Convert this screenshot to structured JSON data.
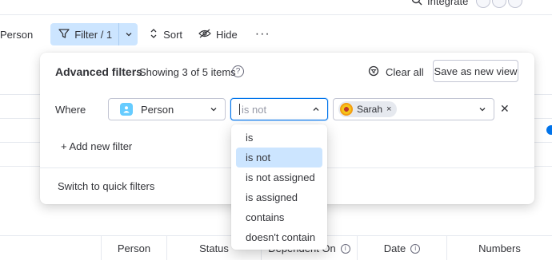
{
  "header": {
    "integrate_label": "Integrate"
  },
  "toolbar": {
    "person_label": "Person",
    "filter_label": "Filter / 1",
    "sort_label": "Sort",
    "hide_label": "Hide",
    "more_label": "···"
  },
  "table": {
    "columns": [
      {
        "label": "Person",
        "info": false
      },
      {
        "label": "Status",
        "info": false
      },
      {
        "label": "Dependent On",
        "info": true
      },
      {
        "label": "Date",
        "info": true
      },
      {
        "label": "Numbers",
        "info": false
      }
    ]
  },
  "filter_panel": {
    "title": "Advanced filters",
    "subtitle": "Showing 3 of 5 items",
    "help_icon": "?",
    "clear_all_label": "Clear all",
    "save_view_label": "Save as new view",
    "where_label": "Where",
    "column_select": {
      "value": "Person",
      "icon": "person-column-icon"
    },
    "condition_select": {
      "value": "is not"
    },
    "value_select": {
      "chip_label": "Sarah",
      "chip_remove": "×"
    },
    "remove_row": "✕",
    "add_filter_label": "+ Add new filter",
    "quick_filters_label": "Switch to quick filters"
  },
  "condition_menu": {
    "options": [
      "is",
      "is not",
      "is not assigned",
      "is assigned",
      "contains",
      "doesn't contain"
    ],
    "selected": "is not"
  },
  "colors": {
    "accent": "#0073ea",
    "selected_bg": "#cce5ff",
    "border": "#c3c6d4"
  }
}
